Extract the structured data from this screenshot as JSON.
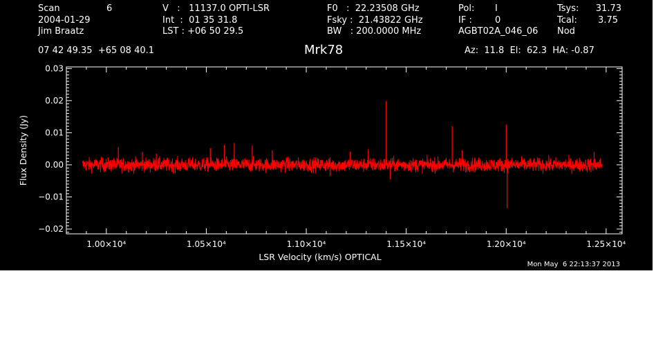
{
  "header": {
    "col1": {
      "scan_label": "Scan",
      "scan_value": "6",
      "date": "2004-01-29",
      "observer": "Jim Braatz"
    },
    "col2": {
      "v_line": "V   :   11137.0 OPTI-LSR",
      "int_line": "Int  :  01 35 31.8",
      "lst_line": "LST : +06 50 29.5"
    },
    "col3": {
      "f0_line": "F0   :  22.23508 GHz",
      "fsky_line": "Fsky :  21.43822 GHz",
      "bw_line": "BW   : 200.0000 MHz"
    },
    "col4": {
      "pol_label": "Pol:",
      "pol_value": "I",
      "if_label": "IF :",
      "if_value": "0",
      "project": "AGBT02A_046_06"
    },
    "col5": {
      "tsys_label": "Tsys:",
      "tsys_value": "31.73",
      "tcal_label": "Tcal:",
      "tcal_value": "3.75",
      "mode": "Nod"
    },
    "coords": "07 42 49.35  +65 08 40.1",
    "source": "Mrk78",
    "pointing": "Az:  11.8  El:  62.3  HA: -0.87"
  },
  "timestamp": "Mon May  6 22:13:37 2013",
  "colors": {
    "background": "#000000",
    "axes": "#ffffff",
    "trace": "#ff0000"
  },
  "chart_data": {
    "type": "line",
    "xlabel": "LSR Velocity (km/s) OPTICAL",
    "ylabel": "Flux Density (Jy)",
    "xlim": [
      9800,
      12580
    ],
    "ylim": [
      -0.0215,
      0.0305
    ],
    "x_tick_values": [
      10000,
      10500,
      11000,
      11500,
      12000,
      12500
    ],
    "x_tick_labels": [
      "1.00×10⁴",
      "1.05×10⁴",
      "1.10×10⁴",
      "1.15×10⁴",
      "1.20×10⁴",
      "1.25×10⁴"
    ],
    "y_tick_values": [
      -0.02,
      -0.01,
      0.0,
      0.01,
      0.02,
      0.03
    ],
    "y_tick_labels": [
      "−0.02",
      "−0.01",
      "0.00",
      "0.01",
      "0.02",
      "0.03"
    ],
    "series": [
      {
        "x_range": [
          9880,
          12480
        ],
        "baseline": 0.0,
        "noise_rms": 0.0011,
        "spikes": [
          {
            "x": 10060,
            "y": 0.0055
          },
          {
            "x": 10180,
            "y": 0.004
          },
          {
            "x": 10250,
            "y": 0.0035
          },
          {
            "x": 10520,
            "y": 0.0052
          },
          {
            "x": 10590,
            "y": 0.0062
          },
          {
            "x": 10640,
            "y": 0.0068
          },
          {
            "x": 10730,
            "y": 0.006
          },
          {
            "x": 10830,
            "y": 0.0045
          },
          {
            "x": 11120,
            "y": -0.0035
          },
          {
            "x": 11220,
            "y": 0.0041
          },
          {
            "x": 11310,
            "y": 0.0048
          },
          {
            "x": 11400,
            "y": 0.0199
          },
          {
            "x": 11420,
            "y": -0.0045
          },
          {
            "x": 11730,
            "y": 0.012
          },
          {
            "x": 11780,
            "y": 0.0045
          },
          {
            "x": 12000,
            "y": 0.0125
          },
          {
            "x": 12005,
            "y": -0.0135
          },
          {
            "x": 12440,
            "y": 0.004
          }
        ]
      }
    ]
  }
}
